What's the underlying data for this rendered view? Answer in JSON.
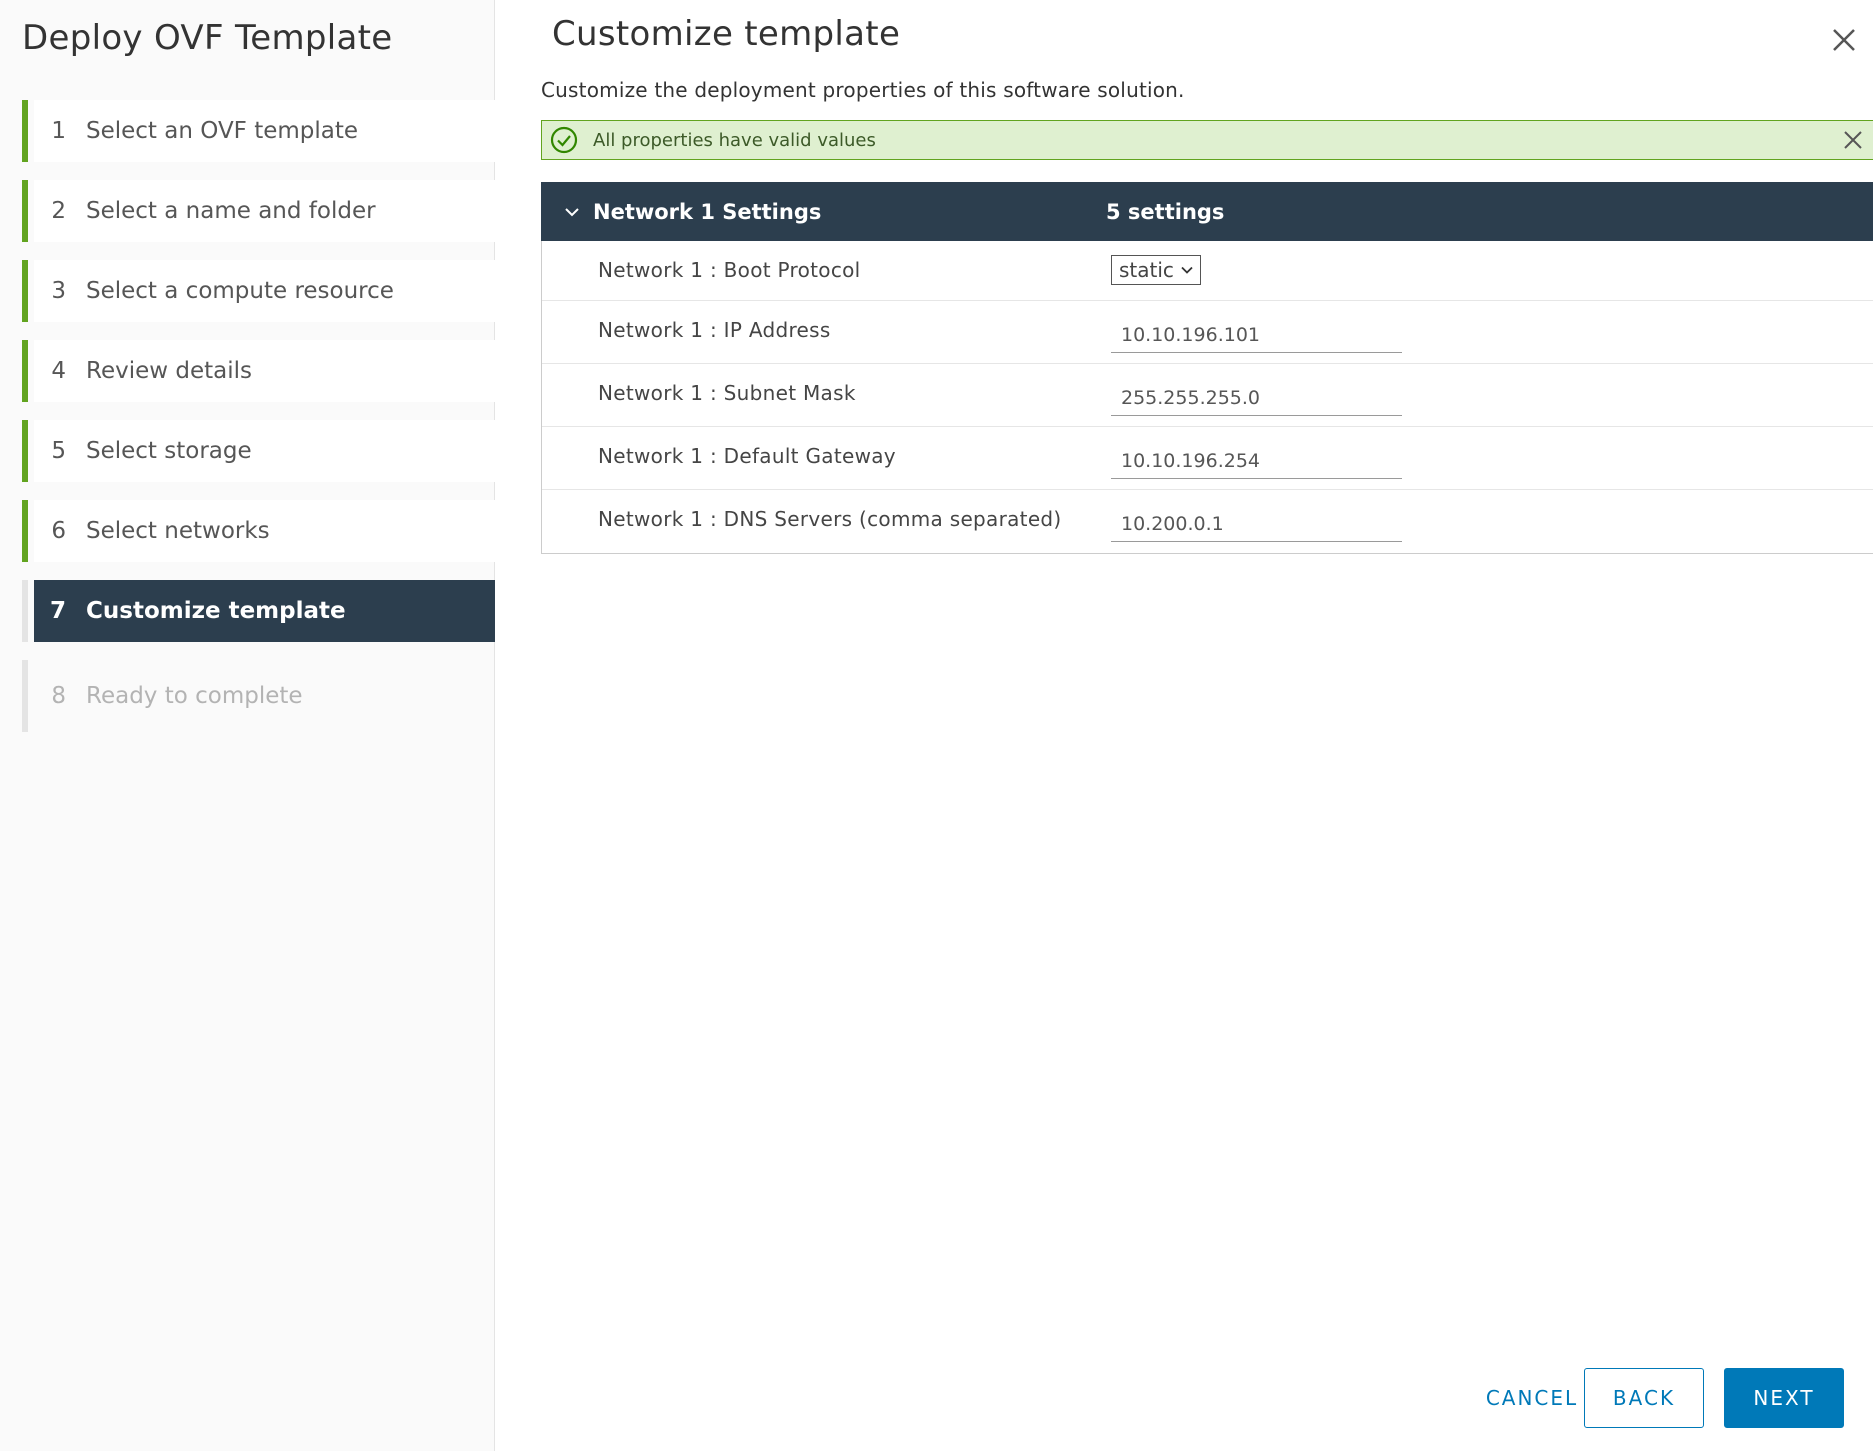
{
  "wizard": {
    "title": "Deploy OVF Template",
    "steps": [
      {
        "num": "1",
        "label": "Select an OVF template",
        "state": "done"
      },
      {
        "num": "2",
        "label": "Select a name and folder",
        "state": "done"
      },
      {
        "num": "3",
        "label": "Select a compute resource",
        "state": "done"
      },
      {
        "num": "4",
        "label": "Review details",
        "state": "done"
      },
      {
        "num": "5",
        "label": "Select storage",
        "state": "done"
      },
      {
        "num": "6",
        "label": "Select networks",
        "state": "done"
      },
      {
        "num": "7",
        "label": "Customize template",
        "state": "active"
      },
      {
        "num": "8",
        "label": "Ready to complete",
        "state": "future"
      }
    ]
  },
  "page": {
    "title": "Customize template",
    "subtitle": "Customize the deployment properties of this software solution.",
    "close_icon": "close-icon"
  },
  "alert": {
    "message": "All properties have valid values",
    "icon": "check-circle-icon",
    "status_color": "#62a420"
  },
  "group": {
    "name": "Network 1 Settings",
    "count": "5 settings",
    "expanded": true,
    "rows": [
      {
        "label": "Network 1 : Boot Protocol",
        "type": "select",
        "value": "static"
      },
      {
        "label": "Network 1 : IP Address",
        "type": "text",
        "value": "10.10.196.101"
      },
      {
        "label": "Network 1 : Subnet Mask",
        "type": "text",
        "value": "255.255.255.0"
      },
      {
        "label": "Network 1 : Default Gateway",
        "type": "text",
        "value": "10.10.196.254"
      },
      {
        "label": "Network 1 : DNS Servers (comma separated)",
        "type": "text",
        "value": "10.200.0.1"
      }
    ]
  },
  "footer": {
    "cancel_label": "CANCEL",
    "back_label": "BACK",
    "next_label": "NEXT"
  },
  "colors": {
    "accent": "#0079b8",
    "header_dark": "#2c3e4e",
    "success": "#62a420",
    "success_bg": "#dff0d0"
  }
}
